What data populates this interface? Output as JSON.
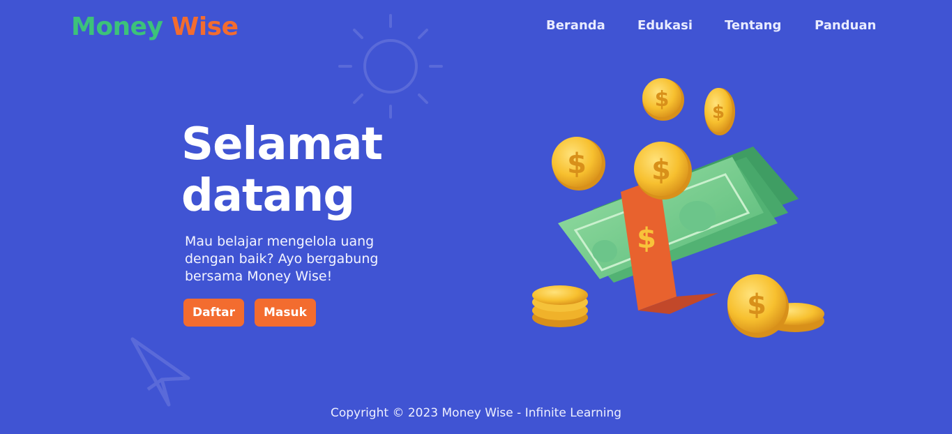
{
  "header": {
    "logo": {
      "part1": "Money",
      "part2": "Wise"
    },
    "nav": [
      {
        "label": "Beranda"
      },
      {
        "label": "Edukasi"
      },
      {
        "label": "Tentang"
      },
      {
        "label": "Panduan"
      }
    ]
  },
  "hero": {
    "title_line1": "Selamat",
    "title_line2": "datang",
    "description": "Mau belajar mengelola uang dengan baik? Ayo bergabung bersama Money Wise!",
    "buttons": {
      "register": "Daftar",
      "login": "Masuk"
    }
  },
  "footer": {
    "copyright": "Copyright © 2023 Money Wise - Infinite Learning"
  },
  "icons": {
    "decoration_top": "sun-icon",
    "decoration_bottom": "paper-plane-icon",
    "illustration": "money-stack-coins-illustration"
  },
  "colors": {
    "background": "#4054d3",
    "logo_green": "#3cc27a",
    "accent_orange": "#f36c2f",
    "money_green": "#4cb878",
    "coin_gold": "#f5b82a"
  }
}
